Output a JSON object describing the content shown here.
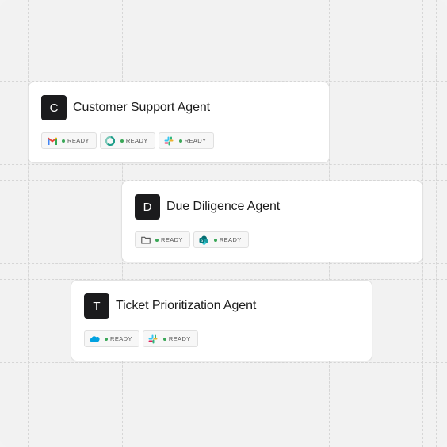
{
  "agents": [
    {
      "initial": "C",
      "name": "Customer Support Agent",
      "tools": [
        {
          "icon": "gmail-icon",
          "status": "READY"
        },
        {
          "icon": "ring-icon",
          "status": "READY"
        },
        {
          "icon": "slack-icon",
          "status": "READY"
        }
      ]
    },
    {
      "initial": "D",
      "name": "Due Diligence Agent",
      "tools": [
        {
          "icon": "folder-icon",
          "status": "READY"
        },
        {
          "icon": "sharepoint-icon",
          "status": "READY"
        }
      ]
    },
    {
      "initial": "T",
      "name": "Ticket Prioritization Agent",
      "tools": [
        {
          "icon": "salesforce-icon",
          "status": "READY"
        },
        {
          "icon": "slack-icon",
          "status": "READY"
        }
      ]
    }
  ],
  "colors": {
    "avatar": "#1b1b1d",
    "ready_dot": "#3aa757",
    "background": "#f2f2f2"
  }
}
